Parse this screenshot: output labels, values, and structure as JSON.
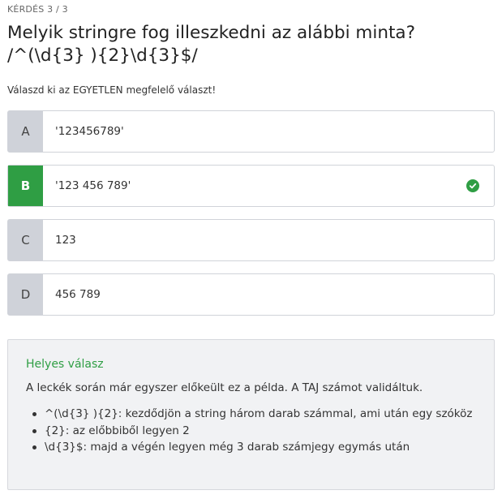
{
  "quiz": {
    "counter": "KÉRDÉS 3 / 3",
    "title_line1": "Melyik stringre fog illeszkedni az alábbi minta?",
    "title_line2": "/^(\\d{3} ){2}\\d{3}$/",
    "instruction": "Válaszd ki az EGYETLEN megfelelő választ!"
  },
  "answers": [
    {
      "letter": "A",
      "text": "'123456789'",
      "correct": false
    },
    {
      "letter": "B",
      "text": "'123 456 789'",
      "correct": true,
      "icon": "check-circle-icon"
    },
    {
      "letter": "C",
      "text": "123",
      "correct": false
    },
    {
      "letter": "D",
      "text": "456 789",
      "correct": false
    }
  ],
  "explanation": {
    "heading": "Helyes válasz",
    "intro": "A leckék során már egyszer előkeült ez a példa. A TAJ számot validáltuk.",
    "items": [
      "^(\\d{3} ){2}: kezdődjön a string három darab számmal, ami után egy szóköz",
      "{2}: az előbbiből legyen 2",
      "\\d{3}$: majd a végén legyen még 3 darab számjegy egymás után"
    ]
  },
  "colors": {
    "accent_green": "#2f9e44",
    "letter_gray": "#cfd2d9",
    "panel_bg": "#f1f2f4"
  }
}
